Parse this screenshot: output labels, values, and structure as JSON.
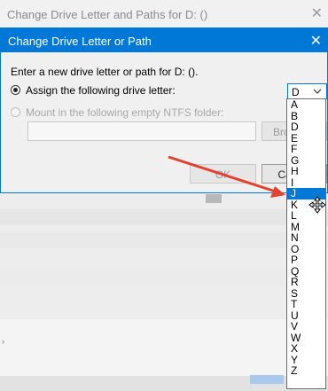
{
  "parent_window": {
    "title": "Change Drive Letter and Paths for D: ()",
    "close_glyph": "✕"
  },
  "dialog": {
    "title": "Change Drive Letter or Path",
    "close_glyph": "✕",
    "prompt": "Enter a new drive letter or path for D: ().",
    "assign_option": {
      "label": "Assign the following drive letter:",
      "selected": true
    },
    "mount_option": {
      "label": "Mount in the following empty NTFS folder:",
      "selected": false,
      "disabled": true
    },
    "folder_input": {
      "value": ""
    },
    "browse_label": "Browse...",
    "ok_label": "OK",
    "cancel_label": "Cancel",
    "drive_select": {
      "value": "D",
      "arrow_icon": "chevron-down-icon"
    }
  },
  "dropdown": {
    "items": [
      "A",
      "B",
      "D",
      "E",
      "F",
      "G",
      "H",
      "I",
      "J",
      "K",
      "L",
      "M",
      "N",
      "O",
      "P",
      "Q",
      "R",
      "S",
      "T",
      "U",
      "V",
      "W",
      "X",
      "Y",
      "Z"
    ],
    "selected": "J"
  },
  "annotation": {
    "arrow_color": "#e2412e"
  },
  "colors": {
    "accent": "#0078d7",
    "selection": "#0078d7",
    "arrow": "#e2412e"
  },
  "cursor": {
    "icon": "resize-move-cursor-icon"
  }
}
